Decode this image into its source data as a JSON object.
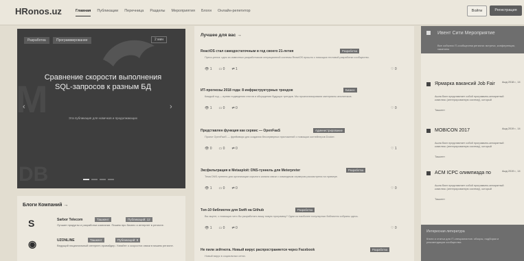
{
  "header": {
    "logo": "HRonos.uz",
    "nav": [
      "Главная",
      "Публикации",
      "Перечница",
      "Разделы",
      "Мероприятия",
      "Блоги",
      "Онлайн-репетитор"
    ],
    "login_label": "Войти",
    "register_label": "Регистрация"
  },
  "hero": {
    "tag_primary": "Разработка",
    "tag_secondary": "Программирование",
    "tag_right": "2 мин",
    "title": "Сравнение скорости выполнения SQL-запросов к разным БД",
    "subtitle": "Эта публикация для новичков и продолжающих",
    "ghost_top": "M",
    "ghost_bottom": "DB",
    "prev_icon": "‹",
    "next_icon": "›"
  },
  "blog": {
    "title": "Блоги Компаний →",
    "items": [
      {
        "icon": "S",
        "name": "Sarbor Telecom",
        "pill1": "Ташкент",
        "pill2": "Публикаций: 12",
        "desc": "Лучшие продукты и разработки компании. Пишем про бизнес и интернет в регионе."
      },
      {
        "icon": "◉",
        "name": "UZONLINE",
        "pill1": "Ташкент",
        "pill2": "Публикаций: 8",
        "desc": "Ведущий национальный интернет-провайдер. Узнайте о скоростях связи в вашем регионе."
      }
    ]
  },
  "feed": {
    "title": "Лучшее для вас →",
    "posts": [
      {
        "title": "ReactOS стал самодостаточным в год своего 21-летия",
        "badge": "Разработка",
        "desc": "Пресс-релиз: одно из известных разработчиков операционной системы ReactOS прошло с помощью тестовой разработки сообщество.",
        "views": "1",
        "comments": "0",
        "reposts": "1",
        "likes": "0"
      },
      {
        "title": "ИТ-прогнозы 2018 года: 8 инфраструктурных трендов",
        "badge": "Бизнес",
        "desc": "Каждый год — время подведения итогов и обсуждения будущих трендов. Мы проанализировали материалы аналитиков.",
        "views": "1",
        "comments": "0",
        "reposts": "0",
        "likes": "0"
      },
      {
        "title": "Представлен функция как сервис — OpenFaaS",
        "badge": "Администрирование",
        "desc": "Проект OpenFaaS — фреймворк для создания бессерверных приложений с помощью контейнеров Docker.",
        "views": "0",
        "comments": "0",
        "reposts": "0",
        "likes": "1"
      },
      {
        "title": "Эксфильтрация в Metasploit: DNS-туннель для Meterpreter",
        "badge": "Разработка",
        "desc": "Тема DNS-туннеля для организации скрытого канала связи с командным сервером рассмотрена на примере.",
        "views": "1",
        "comments": "0",
        "reposts": "0",
        "likes": "0"
      },
      {
        "title": "Топ-10 библиотек для Swift на Github",
        "badge": "Разработка",
        "desc": "Вы ищете, с помощью чего бы разработать вашу новую программу? Одни из наиболее популярных библиотек собраны здесь.",
        "views": "1",
        "comments": "0",
        "reposts": "0",
        "likes": "0"
      },
      {
        "title": "Не пили зейтнота. Новый вирус распространяется через Facebook",
        "badge": "Разработка",
        "desc": "Новый вирус в социальных сетях.",
        "views": "",
        "comments": "",
        "reposts": "",
        "likes": ""
      }
    ]
  },
  "sidebar": {
    "header_title": "Ивент Сити Мероприятие",
    "header_desc": "Все события IT-сообщества региона: встречи, конференции, хакатоны",
    "events": [
      {
        "name": "Ярмарка вакансий Job Fair",
        "date": "Ашд 2018 г., 14",
        "desc": "Ашла Вагл представляет собой программно-аппаратный комплекс (интегрированную систему), который",
        "city": "Ташкент"
      },
      {
        "name": "MOBICON 2017",
        "date": "Ашд 2019 г., 14",
        "desc": "Ашла Вагл представляет собой программно-аппаратный комплекс (интегрированную систему), который",
        "city": "Ташкент"
      },
      {
        "name": "ACM ICPC олимпиада по",
        "date": "Ашд 2019 г., 14",
        "desc": "Ашла Вагл представляет собой программно-аппаратный комплекс (интегрированную систему), который",
        "city": "Ташкент"
      }
    ],
    "footer_title": "Интересная литература",
    "footer_desc": "Книги и статьи для IT-специалистов: обзоры, подборки и рекомендации сообщества"
  }
}
